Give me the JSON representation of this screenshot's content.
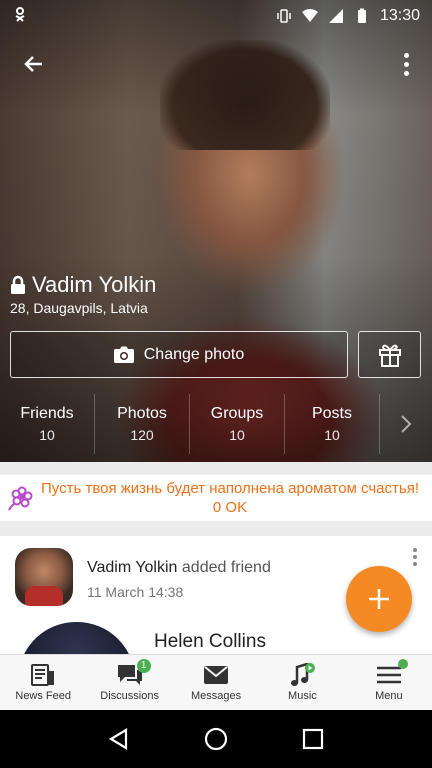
{
  "status_bar": {
    "time": "13:30"
  },
  "profile": {
    "name": "Vadim Yolkin",
    "subtitle": "28, Daugavpils, Latvia",
    "change_photo_label": "Change photo"
  },
  "stats": [
    {
      "label": "Friends",
      "value": "10"
    },
    {
      "label": "Photos",
      "value": "120"
    },
    {
      "label": "Groups",
      "value": "10"
    },
    {
      "label": "Posts",
      "value": "10"
    }
  ],
  "promo": {
    "text": "Пусть твоя жизнь будет наполнена ароматом счастья! 0 OK"
  },
  "feed": {
    "actor": "Vadim Yolkin",
    "action": "added friend",
    "date": "11 March 14:38",
    "friend_name": "Helen Collins"
  },
  "tabs": [
    {
      "label": "News Feed",
      "icon": "news-feed-icon"
    },
    {
      "label": "Discussions",
      "icon": "discussions-icon",
      "badge": "1"
    },
    {
      "label": "Messages",
      "icon": "messages-icon"
    },
    {
      "label": "Music",
      "icon": "music-icon"
    },
    {
      "label": "Menu",
      "icon": "menu-icon"
    }
  ],
  "colors": {
    "accent": "#f58a24",
    "promo_text": "#f07018",
    "badge": "#4caf50"
  }
}
